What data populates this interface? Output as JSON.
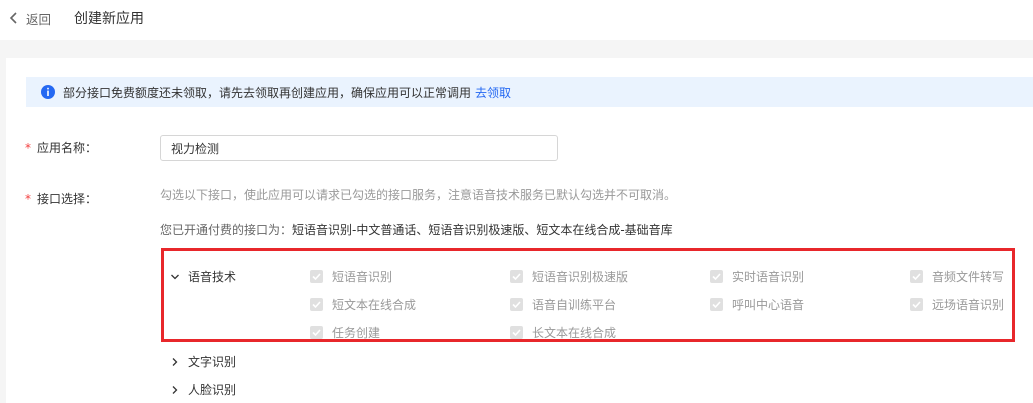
{
  "header": {
    "back_label": "返回",
    "title": "创建新应用"
  },
  "notice": {
    "text": "部分接口免费额度还未领取，请先去领取再创建应用，确保应用可以正常调用",
    "link": "去领取"
  },
  "form": {
    "app_name_label": "应用名称：",
    "app_name_value": "视力检测",
    "api_select_label": "接口选择：",
    "hint": "勾选以下接口，使此应用可以请求已勾选的接口服务，注意语音技术服务已默认勾选并不可取消。",
    "paid_prefix": "您已开通付费的接口为：",
    "paid_items": "短语音识别-中文普通话、短语音识别极速版、短文本在线合成-基础音库"
  },
  "categories": {
    "speech": {
      "name": "语音技术",
      "options": [
        {
          "label": "短语音识别",
          "checked": true,
          "disabled": true
        },
        {
          "label": "短语音识别极速版",
          "checked": true,
          "disabled": true
        },
        {
          "label": "实时语音识别",
          "checked": true,
          "disabled": true
        },
        {
          "label": "音频文件转写",
          "checked": true,
          "disabled": true
        },
        {
          "label": "短文本在线合成",
          "checked": true,
          "disabled": true
        },
        {
          "label": "语音自训练平台",
          "checked": true,
          "disabled": true
        },
        {
          "label": "呼叫中心语音",
          "checked": true,
          "disabled": true
        },
        {
          "label": "远场语音识别",
          "checked": true,
          "disabled": true
        },
        {
          "label": "任务创建",
          "checked": true,
          "disabled": true
        },
        {
          "label": "长文本在线合成",
          "checked": true,
          "disabled": true
        }
      ]
    },
    "ocr": {
      "name": "文字识别"
    },
    "face": {
      "name": "人脸识别"
    }
  },
  "colors": {
    "accent": "#2468f2",
    "required": "#f33e3e",
    "highlight_border": "#e8272b",
    "notice_bg": "#eaf3fe"
  }
}
